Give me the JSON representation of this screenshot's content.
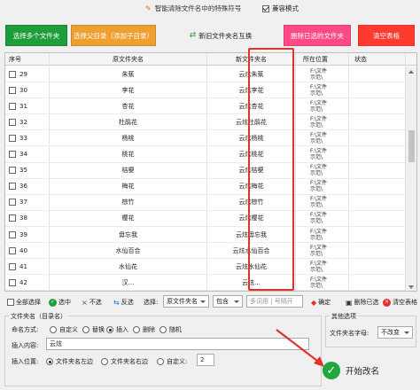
{
  "titlebar": {
    "title": "智能清除文件名中的特殊符号",
    "compat_label": "兼容模式"
  },
  "toolbar": {
    "select_files": "选择多个文件夹",
    "select_parent": "选择父目录（添加子目录）",
    "swap_names": "新旧文件夹名互换",
    "delete_selected": "删除已选的文件夹",
    "clear_table": "清空表格"
  },
  "grid": {
    "headers": {
      "no": "序号",
      "orig": "原文件夹名",
      "new": "新文件夹名",
      "loc": "所在位置",
      "status": "状态"
    },
    "rows": [
      {
        "no": "29",
        "orig": "朱蕉",
        "new": "云炫朱蕉",
        "loc1": "F:\\文件",
        "loc2": "示范\\"
      },
      {
        "no": "30",
        "orig": "李花",
        "new": "云炫李花",
        "loc1": "F:\\文件",
        "loc2": "示范\\"
      },
      {
        "no": "31",
        "orig": "杏花",
        "new": "云炫杏花",
        "loc1": "F:\\文件",
        "loc2": "示范\\"
      },
      {
        "no": "32",
        "orig": "杜鹃花",
        "new": "云炫杜鹃花",
        "loc1": "F:\\文件",
        "loc2": "示范\\"
      },
      {
        "no": "33",
        "orig": "杨桃",
        "new": "云炫杨桃",
        "loc1": "F:\\文件",
        "loc2": "示范\\"
      },
      {
        "no": "34",
        "orig": "桃花",
        "new": "云炫桃花",
        "loc1": "F:\\文件",
        "loc2": "示范\\"
      },
      {
        "no": "35",
        "orig": "桔梗",
        "new": "云炫桔梗",
        "loc1": "F:\\文件",
        "loc2": "示范\\"
      },
      {
        "no": "36",
        "orig": "梅花",
        "new": "云炫梅花",
        "loc1": "F:\\文件",
        "loc2": "示范\\"
      },
      {
        "no": "37",
        "orig": "棕竹",
        "new": "云炫棕竹",
        "loc1": "F:\\文件",
        "loc2": "示范\\"
      },
      {
        "no": "38",
        "orig": "樱花",
        "new": "云炫樱花",
        "loc1": "F:\\文件",
        "loc2": "示范\\"
      },
      {
        "no": "39",
        "orig": "毋忘我",
        "new": "云炫毋忘我",
        "loc1": "F:\\文件",
        "loc2": "示范\\"
      },
      {
        "no": "40",
        "orig": "水仙百合",
        "new": "云炫水仙百合",
        "loc1": "F:\\文件",
        "loc2": "示范\\"
      },
      {
        "no": "41",
        "orig": "水仙花",
        "new": "云炫水仙花",
        "loc1": "F:\\文件",
        "loc2": "示范\\"
      },
      {
        "no": "42",
        "orig": "汉...",
        "new": "云炫...",
        "loc1": "F:\\文件",
        "loc2": "示范\\"
      }
    ]
  },
  "selection_bar": {
    "select_all": "全部选择",
    "check": "选中",
    "uncheck": "不选",
    "invert": "反选",
    "select_label": "选择:",
    "field_option": "原文件夹名",
    "match_option": "包含",
    "multi_placeholder": "多词用 | 号隔开",
    "confirm": "确定",
    "delete_checked": "删除已选",
    "clear_table": "清空表格"
  },
  "form": {
    "group_title": "文件夹名（目录名）",
    "naming_label": "命名方式:",
    "naming_options": [
      "自定义",
      "替换",
      "插入",
      "删除",
      "随机"
    ],
    "insert_label": "插入内容:",
    "insert_value": "云炫",
    "position_label": "插入位置:",
    "position_options": [
      "文件夹名左边",
      "文件夹名右边",
      "自定义:"
    ],
    "position_custom_value": "2"
  },
  "other": {
    "group_title": "其他选项",
    "case_label": "文件夹名字母:",
    "case_value": "不改变"
  },
  "start_button": "开始改名",
  "colors": {
    "green": "#1f9d3a",
    "orange": "#f0a030",
    "pink": "#ff4a86",
    "red": "#ff3b30",
    "highlight": "#e4312b"
  }
}
